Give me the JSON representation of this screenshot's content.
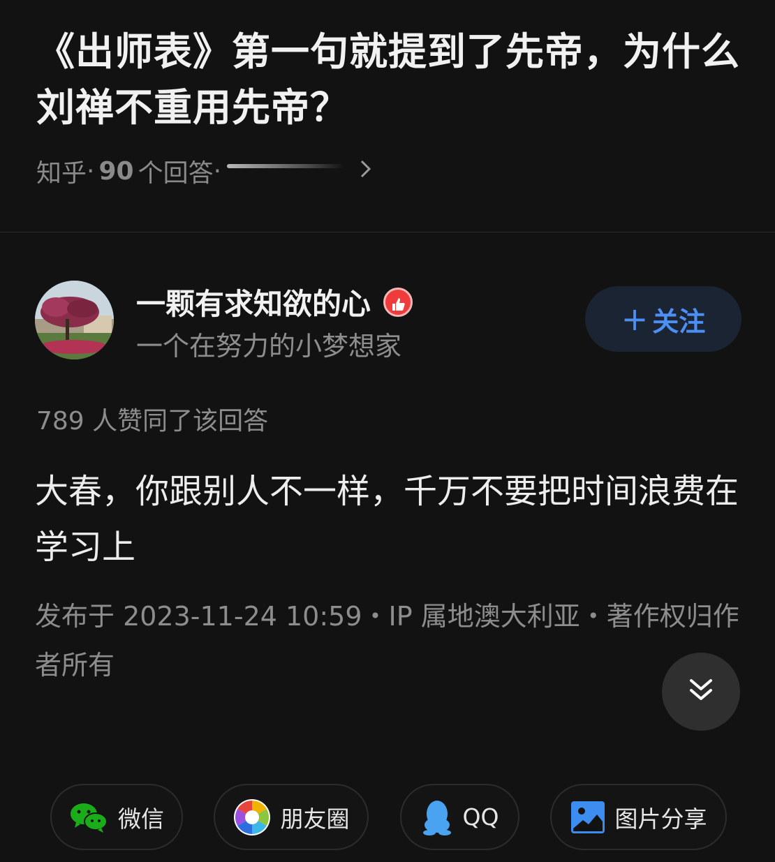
{
  "question": {
    "title": "《出师表》第一句就提到了先帝，为什么刘禅不重用先帝？",
    "source": "知乎",
    "separator": "·",
    "answer_count": "90",
    "answers_label": "个回答"
  },
  "author": {
    "name": "一颗有求知欲的心",
    "bio": "一个在努力的小梦想家",
    "follow_label": "关注",
    "follow_plus": "+"
  },
  "answer": {
    "votes": "789 人赞同了该回答",
    "content": "大春，你跟别人不一样，千万不要把时间浪费在学习上",
    "publish_info": "发布于 2023-11-24 10:59・IP 属地澳大利亚・著作权归作者所有"
  },
  "share": {
    "wechat": "微信",
    "moments": "朋友圈",
    "qq": "QQ",
    "image": "图片分享"
  },
  "colors": {
    "background": "#121212",
    "accent": "#4d8ff5",
    "wechat": "#1aad19",
    "qq": "#4aa3f0",
    "badge": "#ef3b3b"
  },
  "icons": {
    "meta_chevron": "chevron-right-icon",
    "badge": "thumbs-up-badge-icon",
    "collapse": "double-chevron-down-icon"
  }
}
